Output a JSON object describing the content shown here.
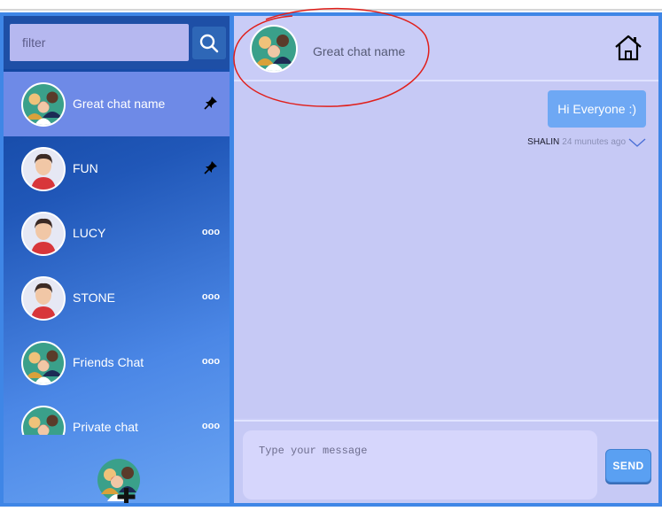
{
  "search": {
    "placeholder": "filter",
    "icon": "search-icon"
  },
  "chats": [
    {
      "name": "Great chat name",
      "avatar": "group-avatar",
      "action": "pin",
      "active": true
    },
    {
      "name": "FUN",
      "avatar": "person-avatar",
      "action": "pin",
      "active": false
    },
    {
      "name": "LUCY",
      "avatar": "person-avatar",
      "action": "more",
      "active": false
    },
    {
      "name": "STONE",
      "avatar": "person-avatar",
      "action": "more",
      "active": false
    },
    {
      "name": "Friends Chat",
      "avatar": "group-avatar",
      "action": "more",
      "active": false
    },
    {
      "name": "Private chat",
      "avatar": "group-avatar",
      "action": "more",
      "active": false
    }
  ],
  "more_label": "ooo",
  "header": {
    "title": "Great chat name",
    "home_icon": "home-icon"
  },
  "messages": [
    {
      "text": "Hi Everyone :)",
      "sender": "SHALIN",
      "time": "24 munutes ago"
    }
  ],
  "composer": {
    "placeholder": "Type your message",
    "send_label": "SEND"
  },
  "colors": {
    "accent": "#3f86e6",
    "bubble": "#6ea8f4",
    "panel": "#c9ccf7",
    "annotation": "#e0201c"
  }
}
